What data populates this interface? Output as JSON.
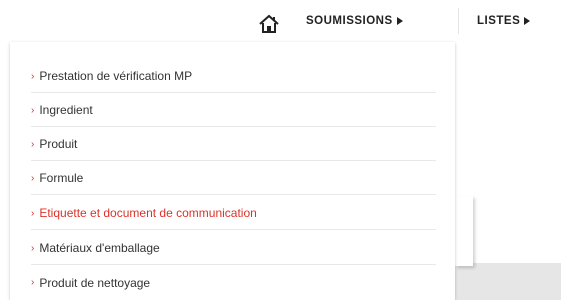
{
  "nav": {
    "home_icon": "home-icon",
    "items": [
      {
        "label": "SOUMISSIONS"
      },
      {
        "label": "LISTES"
      }
    ]
  },
  "dropdown": {
    "chevron": "›",
    "active_color": "#d9342b",
    "items": [
      {
        "label": "Prestation de vérification MP",
        "active": false
      },
      {
        "label": "Ingredient",
        "active": false
      },
      {
        "label": "Produit",
        "active": false
      },
      {
        "label": "Formule",
        "active": false
      },
      {
        "label": "Etiquette et document de communication",
        "active": true
      },
      {
        "label": "Matériaux d'emballage",
        "active": false
      },
      {
        "label": "Produit de nettoyage",
        "active": false
      }
    ]
  }
}
